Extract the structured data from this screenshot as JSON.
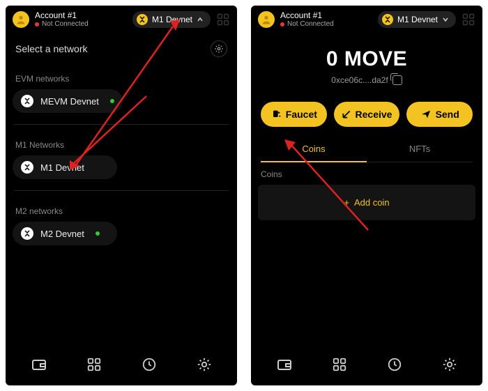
{
  "account": {
    "name": "Account #1",
    "status": "Not Connected"
  },
  "network_selector": {
    "label": "M1 Devnet"
  },
  "left": {
    "title": "Select a network",
    "groups": [
      {
        "label": "EVM networks",
        "items": [
          {
            "name": "MEVM Devnet",
            "online": true
          }
        ]
      },
      {
        "label": "M1 Networks",
        "items": [
          {
            "name": "M1 Devnet",
            "online": false
          }
        ]
      },
      {
        "label": "M2 networks",
        "items": [
          {
            "name": "M2 Devnet",
            "online": true
          }
        ]
      }
    ]
  },
  "right": {
    "balance": "0 MOVE",
    "address": "0xce06c....da2f",
    "actions": {
      "faucet": "Faucet",
      "receive": "Receive",
      "send": "Send"
    },
    "tabs": {
      "coins": "Coins",
      "nfts": "NFTs"
    },
    "coins_label": "Coins",
    "add_coin": "Add coin"
  }
}
